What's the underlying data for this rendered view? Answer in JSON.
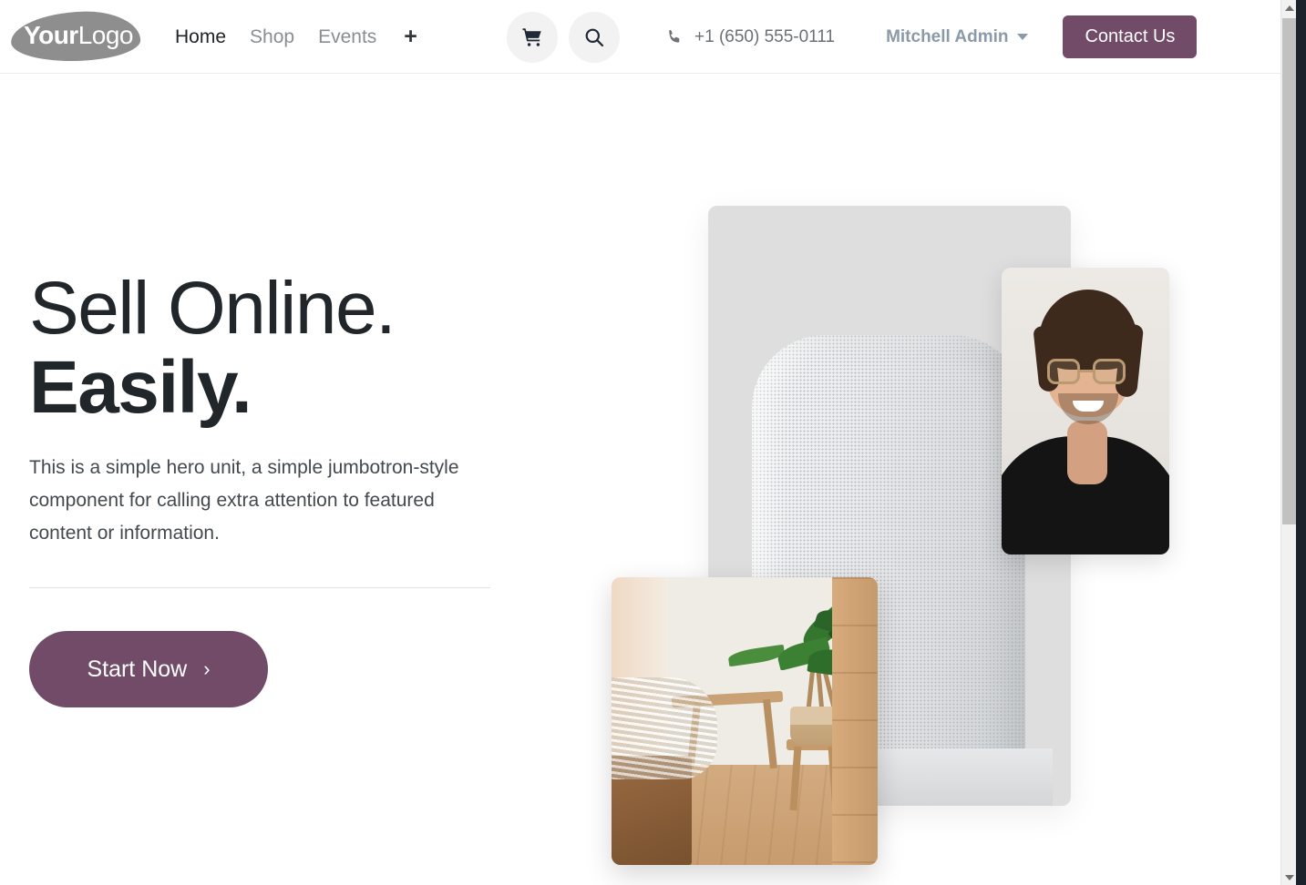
{
  "brand": {
    "logo_primary": "Your",
    "logo_secondary": "Logo",
    "accent_color": "#714B67",
    "logo_blob_color": "#8e8e8e"
  },
  "header": {
    "nav": [
      {
        "label": "Home",
        "active": true
      },
      {
        "label": "Shop",
        "active": false
      },
      {
        "label": "Events",
        "active": false
      }
    ],
    "add_page_label": "+",
    "cart_icon": "shopping-cart-icon",
    "search_icon": "search-icon",
    "phone_icon": "phone-icon",
    "phone_number": "+1 (650) 555-0111",
    "user_name": "Mitchell Admin",
    "user_caret_icon": "chevron-down-icon",
    "contact_button_label": "Contact Us"
  },
  "hero": {
    "heading_line1": "Sell Online.",
    "heading_line2": "Easily.",
    "paragraph": "This is a simple hero unit, a simple jumbotron-style component for calling extra attention to featured content or information.",
    "cta_label": "Start Now",
    "cta_arrow": "chevron-right-icon"
  },
  "collage": {
    "speaker_card": "smart-speaker-image",
    "portrait_card": "person-portrait-image",
    "bedroom_card": "bedroom-interior-image"
  },
  "scrollbar": {
    "up_icon": "scroll-up-arrow-icon",
    "down_icon": "scroll-down-arrow-icon"
  }
}
